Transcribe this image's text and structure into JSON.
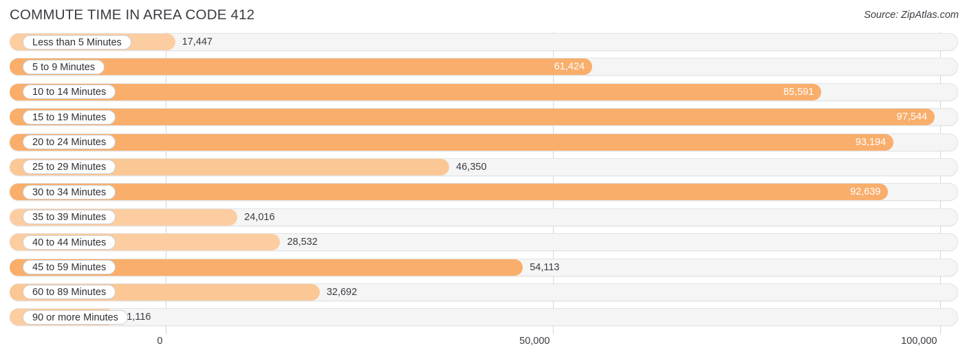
{
  "header": {
    "title": "COMMUTE TIME IN AREA CODE 412",
    "source": "Source: ZipAtlas.com"
  },
  "axis": {
    "ticks": [
      "0",
      "50,000",
      "100,000"
    ]
  },
  "colors": {
    "bar_light": "#fbcda1",
    "bar_mid": "#fbc795",
    "bar_strong": "#f9ae6b",
    "track": "#f5f5f5",
    "gridline": "#d6d6d6",
    "text": "#3b3b43",
    "value_inside": "#ffffff"
  },
  "chart_data": {
    "type": "bar",
    "orientation": "horizontal",
    "title": "COMMUTE TIME IN AREA CODE 412",
    "xlabel": "",
    "ylabel": "",
    "xlim": [
      0,
      100000
    ],
    "grid": true,
    "legend": false,
    "xticks": [
      0,
      50000,
      100000
    ],
    "xtick_labels": [
      "0",
      "50,000",
      "100,000"
    ],
    "categories": [
      "Less than 5 Minutes",
      "5 to 9 Minutes",
      "10 to 14 Minutes",
      "15 to 19 Minutes",
      "20 to 24 Minutes",
      "25 to 29 Minutes",
      "30 to 34 Minutes",
      "35 to 39 Minutes",
      "40 to 44 Minutes",
      "45 to 59 Minutes",
      "60 to 89 Minutes",
      "90 or more Minutes"
    ],
    "values": [
      17447,
      61424,
      85591,
      97544,
      93194,
      46350,
      92639,
      24016,
      28532,
      54113,
      32692,
      11116
    ],
    "value_labels": [
      "17,447",
      "61,424",
      "85,591",
      "97,544",
      "93,194",
      "46,350",
      "92,639",
      "24,016",
      "28,532",
      "54,113",
      "32,692",
      "11,116"
    ]
  },
  "rows": [
    {
      "label": "Less than 5 Minutes",
      "value": "17,447",
      "pct": 17.447,
      "color": "#fbcda1",
      "inside": false
    },
    {
      "label": "5 to 9 Minutes",
      "value": "61,424",
      "pct": 61.424,
      "color": "#f9ae6b",
      "inside": true
    },
    {
      "label": "10 to 14 Minutes",
      "value": "85,591",
      "pct": 85.591,
      "color": "#f9ae6b",
      "inside": true
    },
    {
      "label": "15 to 19 Minutes",
      "value": "97,544",
      "pct": 97.544,
      "color": "#f9ae6b",
      "inside": true
    },
    {
      "label": "20 to 24 Minutes",
      "value": "93,194",
      "pct": 93.194,
      "color": "#f9ae6b",
      "inside": true
    },
    {
      "label": "25 to 29 Minutes",
      "value": "46,350",
      "pct": 46.35,
      "color": "#fbc795",
      "inside": false
    },
    {
      "label": "30 to 34 Minutes",
      "value": "92,639",
      "pct": 92.639,
      "color": "#f9ae6b",
      "inside": true
    },
    {
      "label": "35 to 39 Minutes",
      "value": "24,016",
      "pct": 24.016,
      "color": "#fbcda1",
      "inside": false
    },
    {
      "label": "40 to 44 Minutes",
      "value": "28,532",
      "pct": 28.532,
      "color": "#fbcda1",
      "inside": false
    },
    {
      "label": "45 to 59 Minutes",
      "value": "54,113",
      "pct": 54.113,
      "color": "#f9ae6b",
      "inside": false
    },
    {
      "label": "60 to 89 Minutes",
      "value": "32,692",
      "pct": 32.692,
      "color": "#fbc795",
      "inside": false
    },
    {
      "label": "90 or more Minutes",
      "value": "11,116",
      "pct": 11.116,
      "color": "#fbcda1",
      "inside": false
    }
  ]
}
